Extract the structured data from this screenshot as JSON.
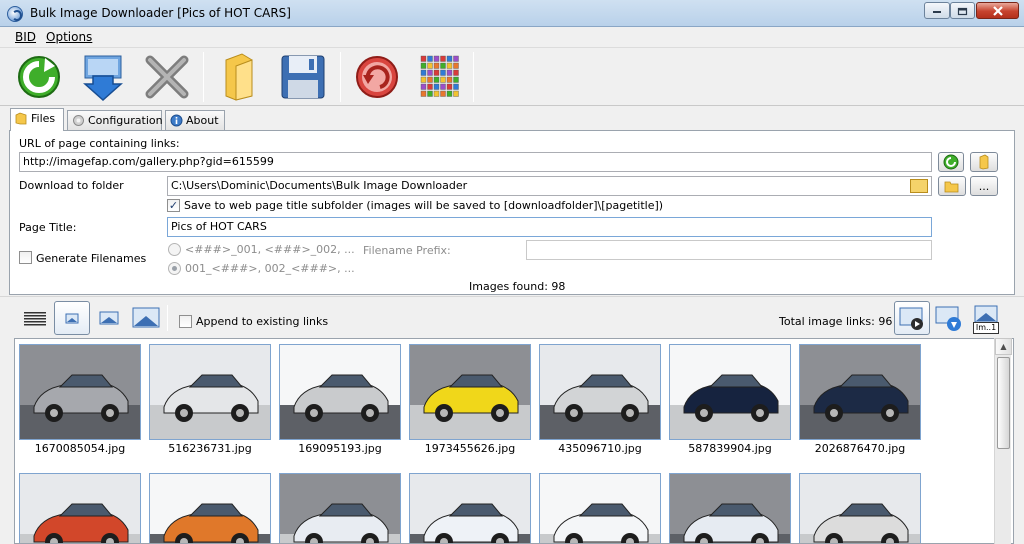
{
  "window": {
    "title": "Bulk Image Downloader [Pics of HOT CARS]"
  },
  "menu": {
    "bid": "BID",
    "options": "Options"
  },
  "tabs": {
    "files": "Files",
    "configuration": "Configuration",
    "about": "About"
  },
  "files": {
    "url_label": "URL of page containing links:",
    "url_value": "http://imagefap.com/gallery.php?gid=615599",
    "download_label": "Download to folder",
    "download_value": "C:\\Users\\Dominic\\Documents\\Bulk Image Downloader",
    "browse_label": "...",
    "subfolder_label": "Save to web page title subfolder (images will be saved to [downloadfolder]\\[pagetitle])",
    "subfolder_checked": true,
    "page_title_label": "Page Title:",
    "page_title_value": "Pics of HOT CARS",
    "generate_label": "Generate Filenames",
    "generate_checked": false,
    "radio_option_1": "<###>_001, <###>_002, ...",
    "radio_option_2": "001_<###>, 002_<###>, ...",
    "prefix_label": "Filename Prefix:",
    "prefix_value": "",
    "images_found": "Images found: 98"
  },
  "viewbar": {
    "append_label": "Append to existing links",
    "append_checked": false,
    "total_links": "Total image links: 96",
    "tooltip_stub": "Im..1"
  },
  "gallery": {
    "items": [
      {
        "file": "1670085054.jpg",
        "color": "#a6a8ad"
      },
      {
        "file": "516236731.jpg",
        "color": "#e4e6e8"
      },
      {
        "file": "169095193.jpg",
        "color": "#c9cbcd"
      },
      {
        "file": "1973455626.jpg",
        "color": "#f0d71a"
      },
      {
        "file": "435096710.jpg",
        "color": "#d2d4d6"
      },
      {
        "file": "587839904.jpg",
        "color": "#16233f"
      },
      {
        "file": "2026876470.jpg",
        "color": "#1c2a45"
      },
      {
        "file": "",
        "color": "#d2472a"
      },
      {
        "file": "",
        "color": "#e0782a"
      },
      {
        "file": "",
        "color": "#e8ecf2"
      },
      {
        "file": "",
        "color": "#eef2f7"
      },
      {
        "file": "",
        "color": "#f4f6f8"
      },
      {
        "file": "",
        "color": "#e6ebf2"
      },
      {
        "file": "",
        "color": "#dcdcdc"
      }
    ]
  },
  "colors": {
    "titlebar": "#b9d1ea",
    "close_button": "#c7432e",
    "thumb_border": "#7fa4cf"
  },
  "icons": {
    "refresh": "green-refresh-icon",
    "download": "blue-download-icon",
    "stop": "gray-x-icon",
    "folder": "folder-icon",
    "save": "floppy-disk-icon",
    "undo": "red-circle-arrow-icon",
    "grid": "color-grid-icon"
  }
}
